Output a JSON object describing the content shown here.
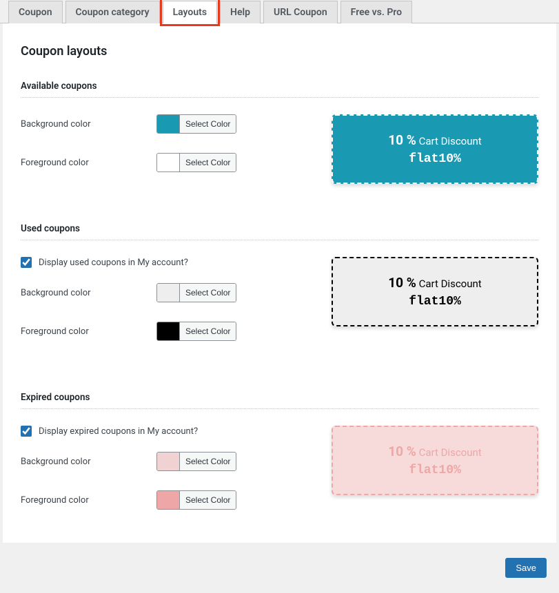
{
  "tabs": {
    "coupon": "Coupon",
    "coupon_category": "Coupon category",
    "layouts": "Layouts",
    "help": "Help",
    "url_coupon": "URL Coupon",
    "free_vs_pro": "Free vs. Pro"
  },
  "page_title": "Coupon layouts",
  "sections": {
    "available": {
      "title": "Available coupons",
      "bg_label": "Background color",
      "fg_label": "Foreground color",
      "bg_color": "#1a9ab2",
      "fg_color": "#ffffff",
      "select_label": "Select Color"
    },
    "used": {
      "title": "Used coupons",
      "display_label": "Display used coupons in My account?",
      "bg_label": "Background color",
      "fg_label": "Foreground color",
      "bg_color": "#eeeeee",
      "fg_color": "#000000",
      "select_label": "Select Color"
    },
    "expired": {
      "title": "Expired coupons",
      "display_label": "Display expired coupons in My account?",
      "bg_label": "Background color",
      "fg_label": "Foreground color",
      "bg_color": "#f1d2d2",
      "fg_color": "#eea6a6",
      "select_label": "Select Color"
    }
  },
  "preview": {
    "percent": "10 %",
    "desc": "Cart Discount",
    "code": "flat10%"
  },
  "save_label": "Save",
  "colors": {
    "available_preview_bg": "#1a9ab2",
    "available_preview_fg": "#ffffff",
    "used_preview_bg": "#eeeeee",
    "used_preview_fg": "#000000",
    "expired_preview_bg": "#f7dada",
    "expired_preview_fg": "#eea6a6"
  }
}
